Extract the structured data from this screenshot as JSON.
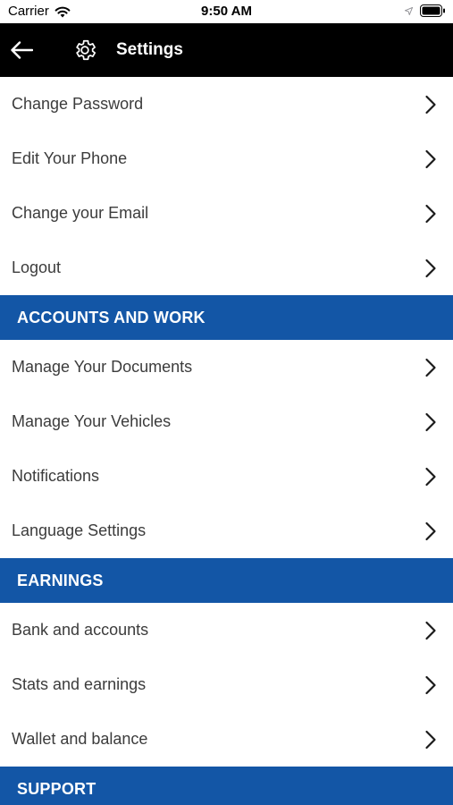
{
  "status_bar": {
    "carrier": "Carrier",
    "time": "9:50 AM"
  },
  "nav": {
    "title": "Settings",
    "back_icon": "arrow-left-icon",
    "title_icon": "gear-icon",
    "background_color": "#000000"
  },
  "account_items": [
    {
      "label": "Change Password"
    },
    {
      "label": "Edit Your Phone"
    },
    {
      "label": "Change your Email"
    },
    {
      "label": "Logout"
    }
  ],
  "sections": [
    {
      "title": "ACCOUNTS AND WORK",
      "items": [
        {
          "label": "Manage Your Documents"
        },
        {
          "label": "Manage Your Vehicles"
        },
        {
          "label": "Notifications"
        },
        {
          "label": "Language Settings"
        }
      ]
    },
    {
      "title": "EARNINGS",
      "items": [
        {
          "label": "Bank and accounts"
        },
        {
          "label": "Stats and earnings"
        },
        {
          "label": "Wallet and balance"
        }
      ]
    },
    {
      "title": "SUPPORT",
      "items": []
    }
  ],
  "colors": {
    "section_header": "#1356a6",
    "row_text": "#3c3c3c"
  },
  "icons": {
    "row_chevron": "chevron-right-icon"
  }
}
